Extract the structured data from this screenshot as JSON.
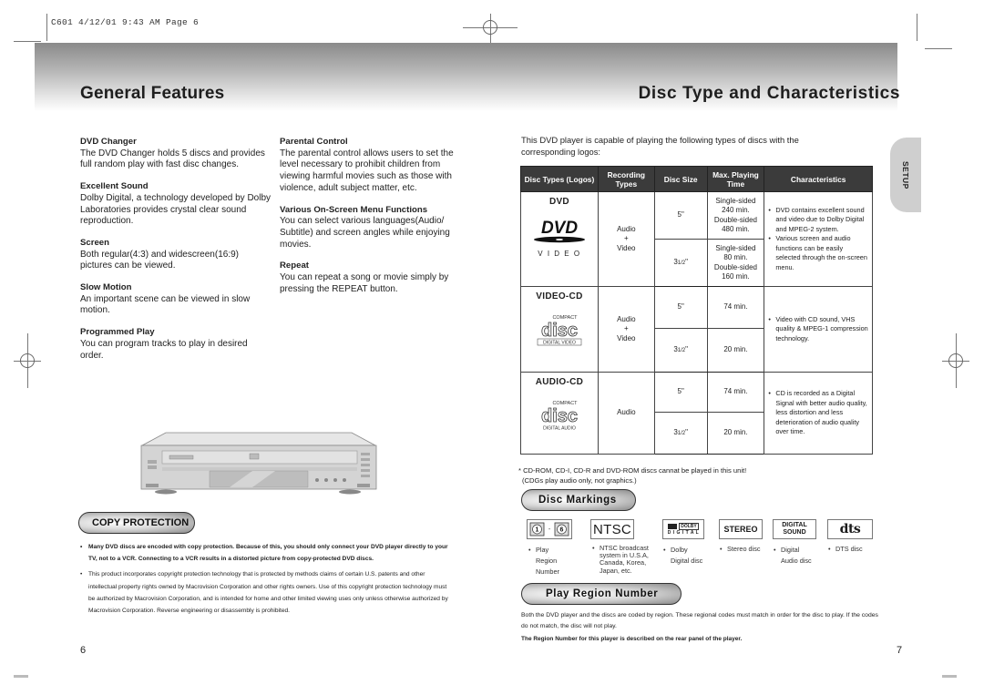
{
  "print_slug": "C601   4/12/01 9:43 AM   Page 6",
  "left_page": {
    "title": "General Features",
    "features_col1": [
      {
        "title": "DVD Changer",
        "body": "The DVD Changer holds 5 discs and provides full random play with fast disc changes."
      },
      {
        "title": "Excellent Sound",
        "body": "Dolby Digital, a technology developed by Dolby Laboratories provides crystal clear sound reproduction."
      },
      {
        "title": "Screen",
        "body": "Both regular(4:3) and widescreen(16:9) pictures can be viewed."
      },
      {
        "title": "Slow Motion",
        "body": "An important scene can be viewed in slow motion."
      },
      {
        "title": "Programmed Play",
        "body": "You can program tracks to play in desired order."
      }
    ],
    "features_col2": [
      {
        "title": "Parental Control",
        "body": "The parental control allows users to set the level necessary to prohibit children from viewing harmful movies such as those with violence, adult subject matter, etc."
      },
      {
        "title": "Various On-Screen Menu Functions",
        "body": "You can select various languages(Audio/ Subtitle) and screen angles while enjoying movies."
      },
      {
        "title": "Repeat",
        "body": "You can repeat a song or movie simply by pressing the REPEAT button."
      }
    ],
    "copy_protection": {
      "heading": "COPY PROTECTION",
      "items": [
        "Many DVD discs are encoded with copy protection. Because of this, you should only connect your DVD player directly to your TV, not to a VCR. Connecting to a VCR results in a distorted picture from copy-protected DVD discs.",
        "This product incorporates copyright protection technology that is protected by methods claims of certain U.S. patents and other intellectual property rights owned by Macrovision Corporation and other rights owners. Use of this copyright protection technology must be authorized by Macrovision Corporation, and is intended for home and other limited viewing uses only unless otherwise authorized by Macrovision Corporation. Reverse engineering or disassembly is prohibited."
      ]
    },
    "page_number": "6"
  },
  "right_page": {
    "title": "Disc Type and Characteristics",
    "side_tab": "SETUP",
    "intro": "This DVD player is capable of playing the following types of discs with the corresponding logos:",
    "table": {
      "headers": [
        "Disc Types (Logos)",
        "Recording Types",
        "Disc Size",
        "Max. Playing Time",
        "Characteristics"
      ],
      "rows": [
        {
          "disc_type": "DVD",
          "logo_caption": "V I D E O",
          "recording": [
            "Audio",
            "+",
            "Video"
          ],
          "sizes": [
            {
              "size": "5\"",
              "time": [
                "Single-sided",
                "240 min.",
                "Double-sided",
                "480 min."
              ]
            },
            {
              "size_main": "3",
              "size_frac": "1/2",
              "size_suffix": "\"",
              "time": [
                "Single-sided",
                "80 min.",
                "Double-sided",
                "160 min."
              ]
            }
          ],
          "characteristics": [
            "DVD contains excellent sound and video due to Dolby Digital and MPEG-2 system.",
            "Various screen and audio functions can be easily selected through the on-screen menu."
          ]
        },
        {
          "disc_type": "VIDEO-CD",
          "logo_top": "COMPACT",
          "logo_main": "disc",
          "logo_caption": "DIGITAL VIDEO",
          "recording": [
            "Audio",
            "+",
            "Video"
          ],
          "sizes": [
            {
              "size": "5\"",
              "time": [
                "74 min."
              ]
            },
            {
              "size_main": "3",
              "size_frac": "1/2",
              "size_suffix": "\"",
              "time": [
                "20 min."
              ]
            }
          ],
          "characteristics": [
            "Video with CD sound, VHS quality & MPEG-1 compression technology."
          ]
        },
        {
          "disc_type": "AUDIO-CD",
          "logo_top": "COMPACT",
          "logo_main": "disc",
          "logo_caption": "DIGITAL AUDIO",
          "recording": [
            "Audio"
          ],
          "sizes": [
            {
              "size": "5\"",
              "time": [
                "74 min."
              ]
            },
            {
              "size_main": "3",
              "size_frac": "1/2",
              "size_suffix": "\"",
              "time": [
                "20 min."
              ]
            }
          ],
          "characteristics": [
            "CD is recorded as a Digital Signal with better audio quality, less distortion and less deterioration of audio quality over time."
          ]
        }
      ]
    },
    "footnote": [
      "* CD-ROM, CD-I, CD-R and DVD-ROM discs cannat be played in this unit!",
      "(CDGs play audio only, not graphics.)"
    ],
    "disc_markings": {
      "heading": "Disc Markings",
      "items": [
        {
          "icon": "region-number-icon",
          "label_a": "1",
          "label_b": "6",
          "caption": [
            "Play",
            "Region",
            "Number"
          ]
        },
        {
          "icon": "ntsc-logo",
          "label": "NTSC",
          "caption": [
            "NTSC broadcast",
            "system in U.S.A,",
            "Canada, Korea,",
            "Japan, etc."
          ]
        },
        {
          "icon": "dolby-digital-logo",
          "label_top": "DOLBY",
          "label": "D I G I T A L",
          "caption": [
            "Dolby",
            "Digital disc"
          ]
        },
        {
          "icon": "stereo-logo",
          "label": "STEREO",
          "caption": [
            "Stereo disc"
          ]
        },
        {
          "icon": "digital-sound-logo",
          "label": "DIGITAL",
          "label2": "SOUND",
          "caption": [
            "Digital",
            "Audio disc"
          ]
        },
        {
          "icon": "dts-logo",
          "label": "dts",
          "caption": [
            "DTS disc"
          ]
        }
      ]
    },
    "play_region": {
      "heading": "Play Region Number",
      "body": "Both the DVD player and the discs are coded by region. These regional codes must match in order for the disc to play. If the codes do not match, the disc will not play.",
      "note": "The Region Number for this player is described on the rear panel of the player."
    },
    "page_number": "7"
  }
}
